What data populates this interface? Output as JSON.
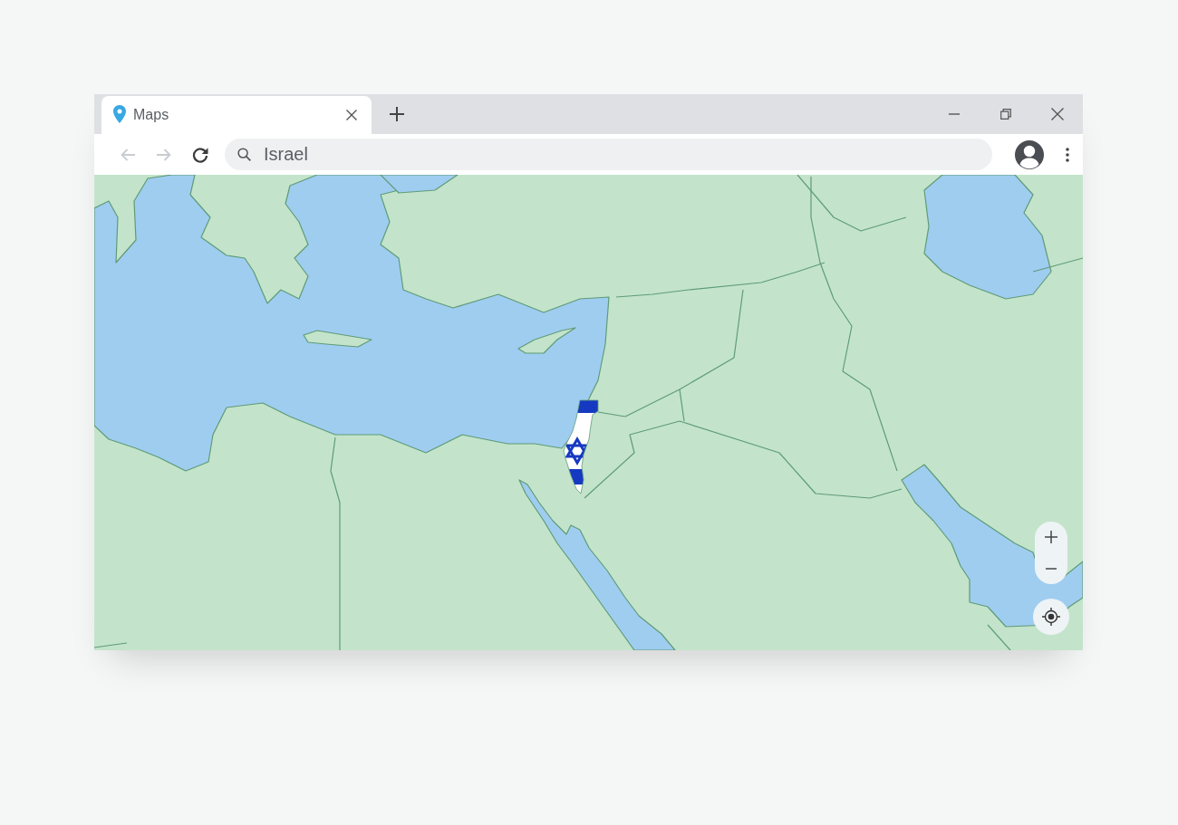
{
  "tabs": [
    {
      "label": "Maps",
      "selected": true
    }
  ],
  "toolbar": {
    "nav_buttons": [
      {
        "kind": "back",
        "disabled": true
      },
      {
        "kind": "forward",
        "disabled": true
      },
      {
        "kind": "reload",
        "disabled": false
      }
    ]
  },
  "address_bar": {
    "value": "Israel"
  }
}
